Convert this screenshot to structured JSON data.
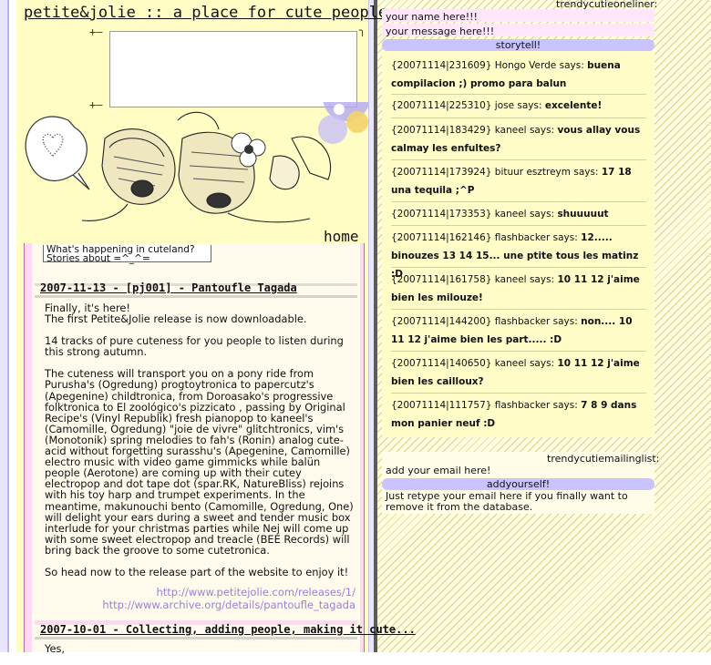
{
  "site": {
    "title": "petite&jolie :: a place for cute people",
    "home_label": "home"
  },
  "intro": {
    "line1": "What's happening in cuteland?",
    "line2": "Stories about =^_^="
  },
  "posts": [
    {
      "title": "2007-11-13 - [pj001] - Pantoufle Tagada",
      "paragraphs": [
        "Finally, it's here!\nThe first Petite&Jolie release is now downloadable.",
        "14 tracks of pure cuteness for you people to listen during this strong autumn.",
        "The cuteness will transport you on a pony ride from Purusha's (Ogredung) progtoytronica to papercutz's (Apegenine) childtronica, from Doroasako's progressive folktronica to El zoológico's pizzicato , passing by Original Recipe's (Vinyl Republik) fresh pianopop to kaneel's (Camomille, Ogredung) \"joie de vivre\" glitchtronics, vim's (Monotonik) spring melodies to fah's (Ronin) analog cute-acid without forgetting surasshu's (Apegenine, Camomille) electro music with video game gimmicks while balün people (Aerotone) are coming up with their cutey electropop and dot tape dot (spar.RK, NatureBliss) rejoins with his toy harp and trumpet experiments. In the meantime, makunouchi bento (Camomille, Ogredung, One) will delight your ears during a sweet and tender music box interlude for your christmas parties while Nej will come up with some sweet electropop and treacle (BEE Records) will bring back the groove to some cutetronica.",
        "So head now to the release part of the website to enjoy it!"
      ],
      "links": [
        "http://www.petitejolie.com/releases/1/",
        "http://www.archive.org/details/pantoufle_tagada"
      ]
    },
    {
      "title": "2007-10-01 - Collecting, adding people, making it cute...",
      "paragraphs": [
        "Yes,"
      ]
    }
  ],
  "oneliner": {
    "heading": "trendycutieoneliner:",
    "name_placeholder": "your name here!!!",
    "message_placeholder": "your message here!!!",
    "button": "storytell!"
  },
  "shouts": [
    {
      "stamp": "{20071114|231609}",
      "user": "Hongo Verde",
      "says": "says:",
      "msg": "buena compilacion ;) promo para balun"
    },
    {
      "stamp": "{20071114|225310}",
      "user": "jose",
      "says": "says:",
      "msg": "excelente!"
    },
    {
      "stamp": "{20071114|183429}",
      "user": "kaneel",
      "says": "says:",
      "msg": "vous allay vous calmay les enfultes?"
    },
    {
      "stamp": "{20071114|173924}",
      "user": "bituur esztreym",
      "says": "says:",
      "msg": "17 18 una tequila ;^P"
    },
    {
      "stamp": "{20071114|173353}",
      "user": "kaneel",
      "says": "says:",
      "msg": "shuuuuut"
    },
    {
      "stamp": "{20071114|162146}",
      "user": "flashbacker",
      "says": "says:",
      "msg": "12..... binouzes 13 14 15... une ptite tous les matinz :D"
    },
    {
      "stamp": "{20071114|161758}",
      "user": "kaneel",
      "says": "says:",
      "msg": "10 11 12 j'aime bien les milouze!"
    },
    {
      "stamp": "{20071114|144200}",
      "user": "flashbacker",
      "says": "says:",
      "msg": "non.... 10 11 12 j'aime bien les part..... :D"
    },
    {
      "stamp": "{20071114|140650}",
      "user": "kaneel",
      "says": "says:",
      "msg": "10 11 12 j'aime bien les cailloux?"
    },
    {
      "stamp": "{20071114|111757}",
      "user": "flashbacker",
      "says": "says:",
      "msg": "7 8 9 dans mon panier neuf :D"
    }
  ],
  "mailinglist": {
    "heading": "trendycutiemailinglist:",
    "email_placeholder": "add your email here!",
    "button": "addyourself!",
    "note": "Just retype your email here if you finally want to remove it from the database."
  },
  "colors": {
    "left_bg": "#fffcc4",
    "content_pink": "#ffd9f2",
    "button_lavender": "#c9c4ff",
    "link_purple": "#9a7fd6"
  }
}
